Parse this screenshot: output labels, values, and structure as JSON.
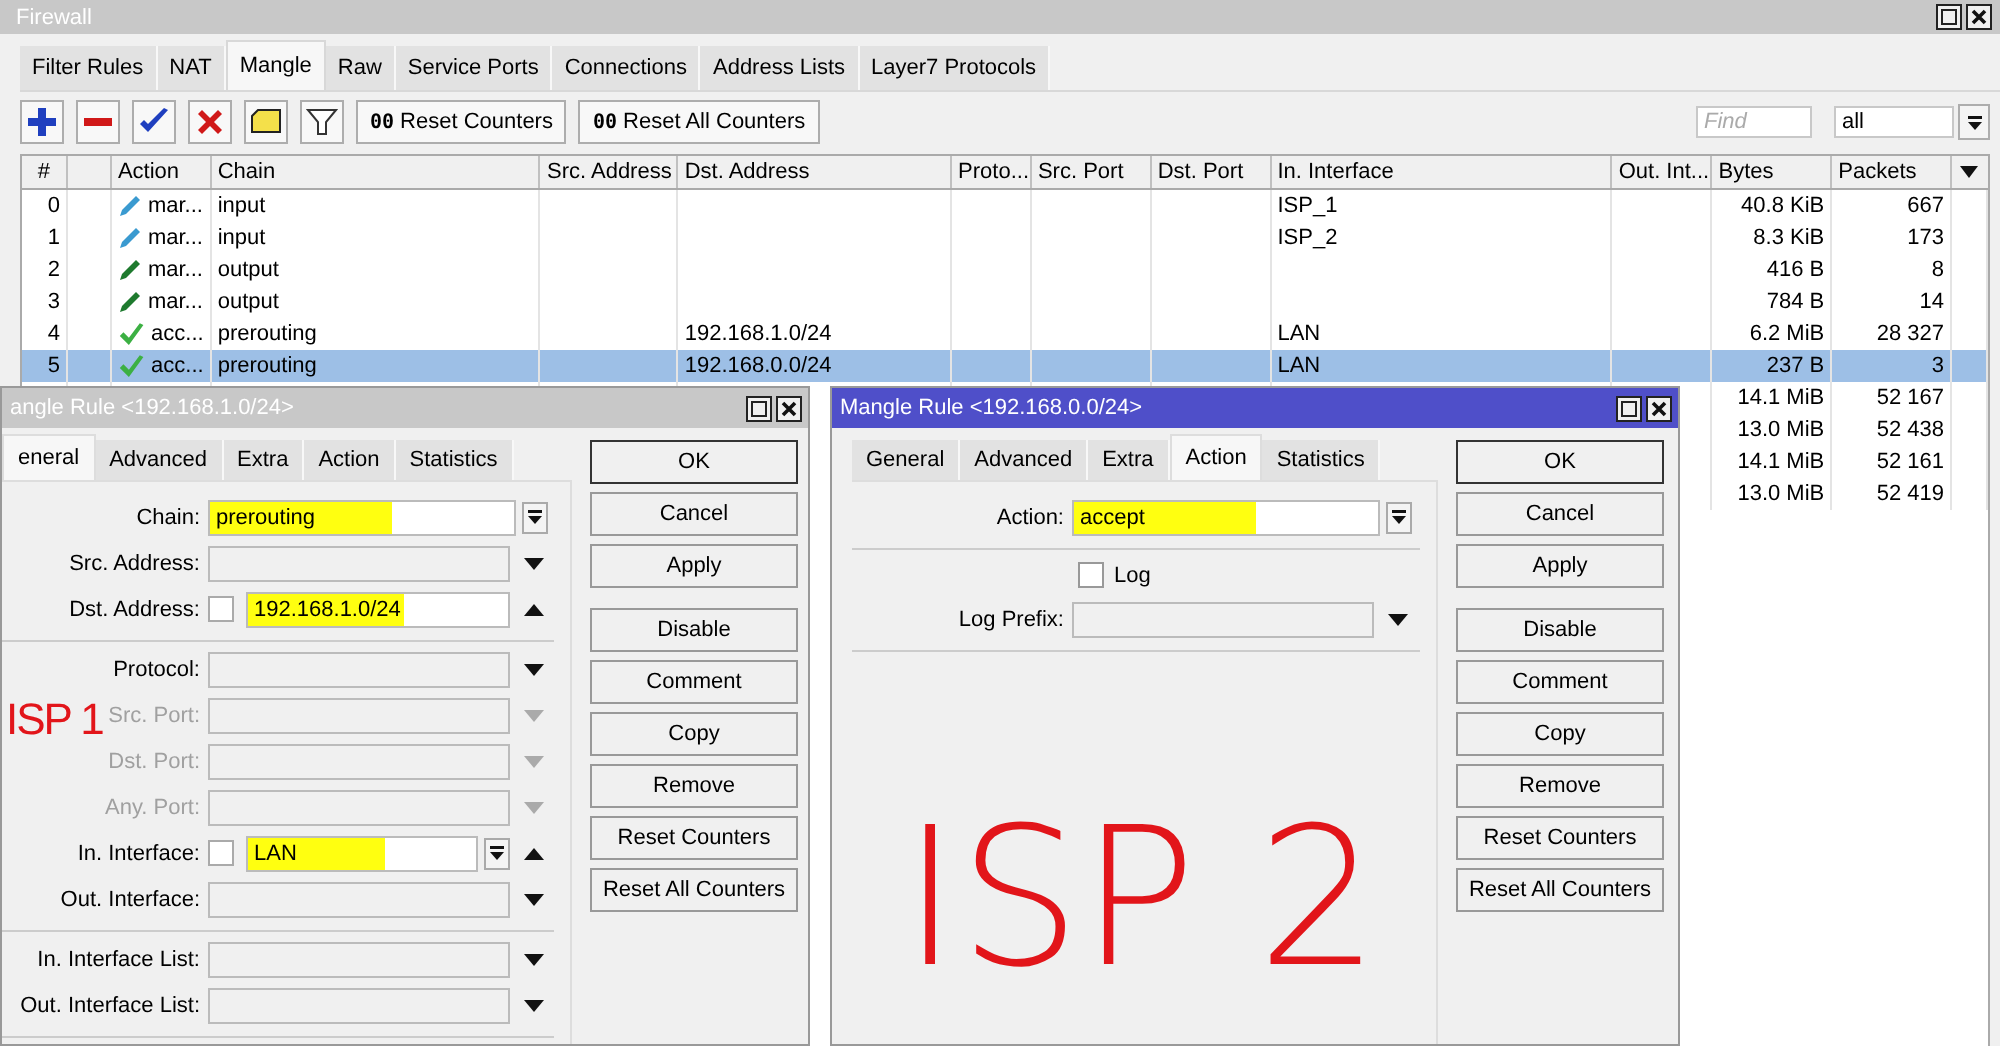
{
  "main_window": {
    "title": "Firewall",
    "tabs": [
      {
        "label": "Filter Rules",
        "selected": false
      },
      {
        "label": "NAT",
        "selected": false
      },
      {
        "label": "Mangle",
        "selected": true
      },
      {
        "label": "Raw",
        "selected": false
      },
      {
        "label": "Service Ports",
        "selected": false
      },
      {
        "label": "Connections",
        "selected": false
      },
      {
        "label": "Address Lists",
        "selected": false
      },
      {
        "label": "Layer7 Protocols",
        "selected": false
      }
    ],
    "toolbar": {
      "icon_buttons": [
        {
          "kind": "add"
        },
        {
          "kind": "remove"
        },
        {
          "kind": "enable"
        },
        {
          "kind": "disable"
        },
        {
          "kind": "comment"
        },
        {
          "kind": "filter"
        }
      ],
      "counter_buttons": [
        {
          "icon_text": "00",
          "label": "Reset Counters"
        },
        {
          "icon_text": "00",
          "label": "Reset All Counters"
        }
      ],
      "find": {
        "placeholder": "Find"
      },
      "filter_select": {
        "value": "all"
      }
    },
    "table": {
      "columns": [
        "#",
        "Action",
        "Chain",
        "Src. Address",
        "Dst. Address",
        "Proto...",
        "Src. Port",
        "Dst. Port",
        "In. Interface",
        "Out. Int...",
        "Bytes",
        "Packets"
      ],
      "rows": [
        {
          "number": "0",
          "action": {
            "kind": "pencil",
            "color": "#3a9ad0",
            "label": "mar..."
          },
          "chain": "input",
          "in_interface": "ISP_1",
          "bytes": "40.8 KiB",
          "packets": "667",
          "selected": false
        },
        {
          "number": "1",
          "action": {
            "kind": "pencil",
            "color": "#3a9ad0",
            "label": "mar..."
          },
          "chain": "input",
          "in_interface": "ISP_2",
          "bytes": "8.3 KiB",
          "packets": "173",
          "selected": false
        },
        {
          "number": "2",
          "action": {
            "kind": "pencil",
            "color": "#1e7a2e",
            "label": "mar..."
          },
          "chain": "output",
          "bytes": "416 B",
          "packets": "8",
          "selected": false
        },
        {
          "number": "3",
          "action": {
            "kind": "pencil",
            "color": "#1e7a2e",
            "label": "mar..."
          },
          "chain": "output",
          "bytes": "784 B",
          "packets": "14",
          "selected": false
        },
        {
          "number": "4",
          "action": {
            "kind": "check",
            "color": "#3cb043",
            "label": "acc..."
          },
          "chain": "prerouting",
          "dst_address": "192.168.1.0/24",
          "in_interface": "LAN",
          "bytes": "6.2 MiB",
          "packets": "28 327",
          "selected": false
        },
        {
          "number": "5",
          "action": {
            "kind": "check",
            "color": "#3cb043",
            "label": "acc..."
          },
          "chain": "prerouting",
          "dst_address": "192.168.0.0/24",
          "in_interface": "LAN",
          "bytes": "237 B",
          "packets": "3",
          "selected": true
        },
        {
          "bytes": "14.1 MiB",
          "packets": "52 167",
          "selected": false
        },
        {
          "bytes": "13.0 MiB",
          "packets": "52 438",
          "selected": false
        },
        {
          "bytes": "14.1 MiB",
          "packets": "52 161",
          "selected": false
        },
        {
          "bytes": "13.0 MiB",
          "packets": "52 419",
          "selected": false
        }
      ]
    }
  },
  "dialogs": [
    {
      "title": "angle Rule <192.168.1.0/24>",
      "active": false,
      "tabs": [
        {
          "label": "eneral",
          "selected": true
        },
        {
          "label": "Advanced",
          "selected": false
        },
        {
          "label": "Extra",
          "selected": false
        },
        {
          "label": "Action",
          "selected": false
        },
        {
          "label": "Statistics",
          "selected": false
        }
      ],
      "groups": [
        [
          {
            "kind": "field",
            "label": "Chain:",
            "value": "prerouting",
            "highlight": true,
            "disabled": false,
            "controls": [
              {
                "kind": "dropdown"
              }
            ]
          },
          {
            "kind": "field",
            "label": "Src. Address:",
            "highlight": false,
            "disabled": false,
            "controls": [
              {
                "kind": "down"
              }
            ]
          },
          {
            "kind": "field",
            "label": "Dst. Address:",
            "value": "192.168.1.0/24",
            "negate": false,
            "highlight": true,
            "disabled": false,
            "controls": [
              {
                "kind": "up"
              }
            ]
          }
        ],
        [
          {
            "kind": "field",
            "label": "Protocol:",
            "highlight": false,
            "disabled": false,
            "controls": [
              {
                "kind": "down"
              }
            ]
          },
          {
            "kind": "field",
            "label": "Src. Port:",
            "highlight": false,
            "disabled": true,
            "controls": [
              {
                "kind": "down"
              }
            ]
          },
          {
            "kind": "field",
            "label": "Dst. Port:",
            "highlight": false,
            "disabled": true,
            "controls": [
              {
                "kind": "down"
              }
            ]
          },
          {
            "kind": "field",
            "label": "Any. Port:",
            "highlight": false,
            "disabled": true,
            "controls": [
              {
                "kind": "down"
              }
            ]
          },
          {
            "kind": "field",
            "label": "In. Interface:",
            "value": "LAN",
            "negate": false,
            "highlight": true,
            "disabled": false,
            "controls": [
              {
                "kind": "dropdown"
              },
              {
                "kind": "up"
              }
            ]
          },
          {
            "kind": "field",
            "label": "Out. Interface:",
            "highlight": false,
            "disabled": false,
            "controls": [
              {
                "kind": "down"
              }
            ]
          }
        ],
        [
          {
            "kind": "field",
            "label": "In. Interface List:",
            "highlight": false,
            "disabled": false,
            "controls": [
              {
                "kind": "down"
              }
            ]
          },
          {
            "kind": "field",
            "label": "Out. Interface List:",
            "highlight": false,
            "disabled": false,
            "controls": [
              {
                "kind": "down"
              }
            ]
          }
        ]
      ],
      "buttons": [
        "OK",
        "Cancel",
        "Apply",
        "Disable",
        "Comment",
        "Copy",
        "Remove",
        "Reset Counters",
        "Reset All Counters"
      ],
      "annotation": "ISP 1"
    },
    {
      "title": "Mangle Rule <192.168.0.0/24>",
      "active": true,
      "tabs": [
        {
          "label": "General",
          "selected": false
        },
        {
          "label": "Advanced",
          "selected": false
        },
        {
          "label": "Extra",
          "selected": false
        },
        {
          "label": "Action",
          "selected": true
        },
        {
          "label": "Statistics",
          "selected": false
        }
      ],
      "groups": [
        [
          {
            "kind": "field",
            "label": "Action:",
            "value": "accept",
            "highlight": true,
            "disabled": false,
            "controls": [
              {
                "kind": "dropdown"
              }
            ]
          }
        ],
        [
          {
            "kind": "checkbox",
            "label": "Log",
            "checked": false
          },
          {
            "kind": "field",
            "label": "Log Prefix:",
            "highlight": false,
            "disabled": false,
            "controls": [
              {
                "kind": "down"
              }
            ]
          }
        ]
      ],
      "buttons": [
        "OK",
        "Cancel",
        "Apply",
        "Disable",
        "Comment",
        "Copy",
        "Remove",
        "Reset Counters",
        "Reset All Counters"
      ],
      "annotation": "ISP 2"
    }
  ]
}
